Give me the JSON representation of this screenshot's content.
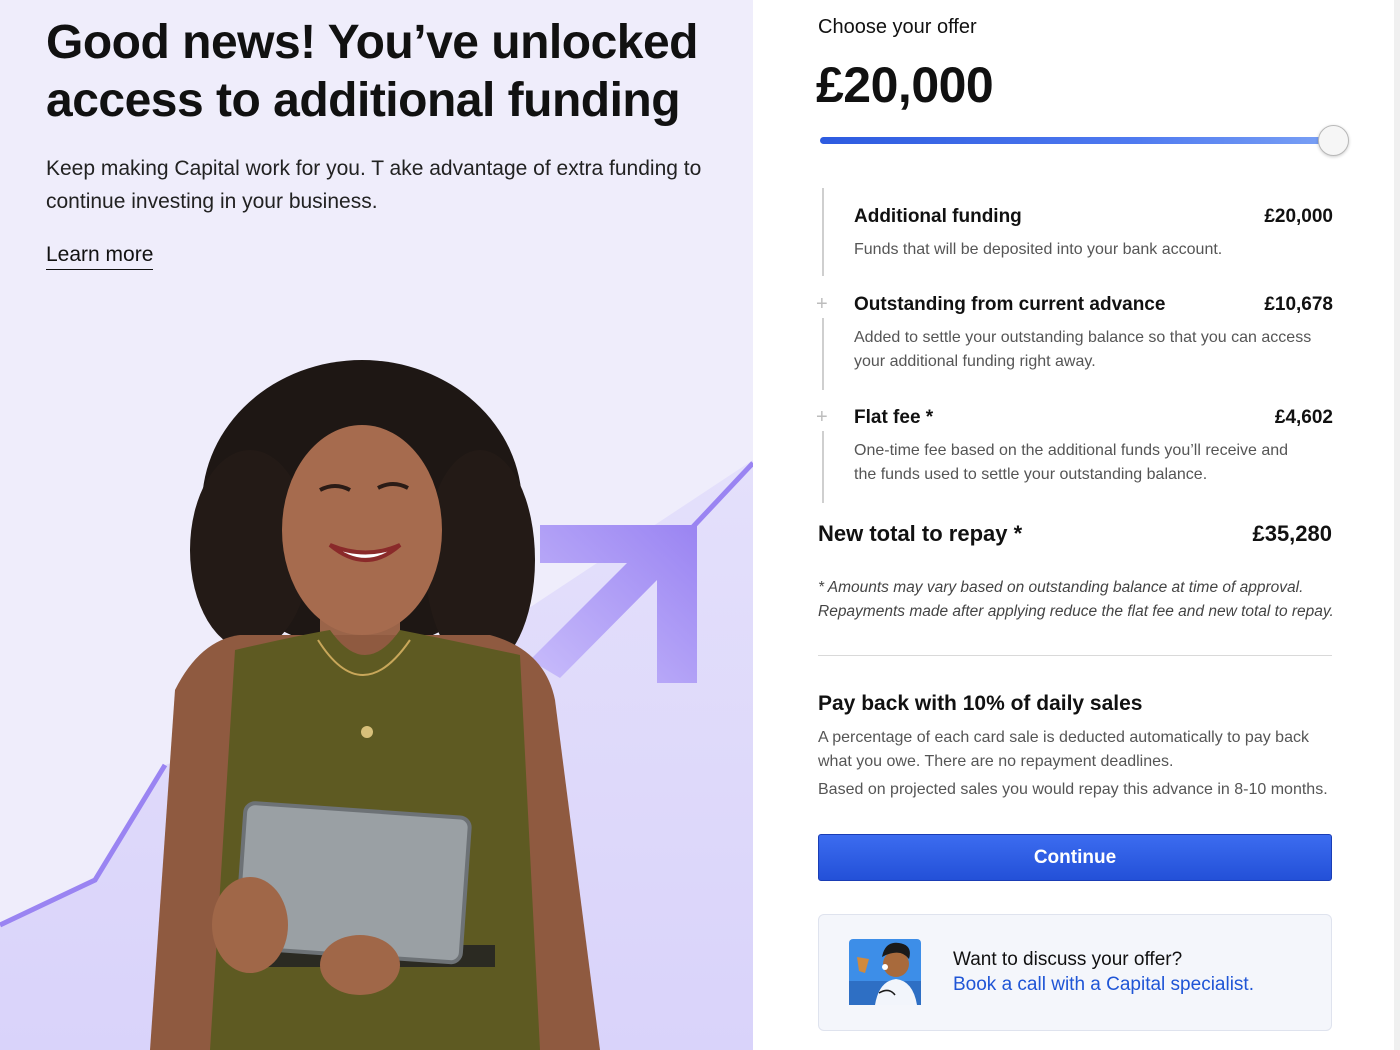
{
  "hero": {
    "headline": "Good news! You’ve unlocked access to additional funding",
    "lead": "Keep making Capital work for you. T ake advantage of extra funding to continue investing in your business.",
    "learn_more": "Learn more"
  },
  "offer": {
    "label": "Choose your offer",
    "amount": "£20,000",
    "slider_fraction": 1.0,
    "breakdown": [
      {
        "title": "Additional funding",
        "value": "£20,000",
        "description": "Funds that will be deposited into your bank account."
      },
      {
        "title": "Outstanding from current advance",
        "value": "£10,678",
        "description": "Added to settle your outstanding balance so that you can access your additional funding right away."
      },
      {
        "title": "Flat fee *",
        "value": "£4,602",
        "description": "One-time fee based on the additional funds you’ll receive and the funds used to settle your outstanding balance."
      }
    ],
    "plus_symbol": "+",
    "total_label": "New total to repay *",
    "total_value": "£35,280",
    "footnote": "* Amounts may vary based on outstanding balance at time of approval. Repayments made after applying reduce the flat fee and new total to repay."
  },
  "payback": {
    "title": "Pay back with 10% of daily sales",
    "description": "A percentage of each card sale is deducted automatically to pay back what you owe. There are no repayment deadlines.",
    "projection": "Based on projected sales you would repay this advance in 8-10 months."
  },
  "continue_label": "Continue",
  "discuss": {
    "title": "Want to discuss your offer?",
    "link": "Book a call with a Capital specialist."
  },
  "colors": {
    "left_bg": "#efedfb",
    "accent_purple": "#9a86f2",
    "button_blue": "#2d5be0",
    "link_blue": "#1f55d6"
  }
}
